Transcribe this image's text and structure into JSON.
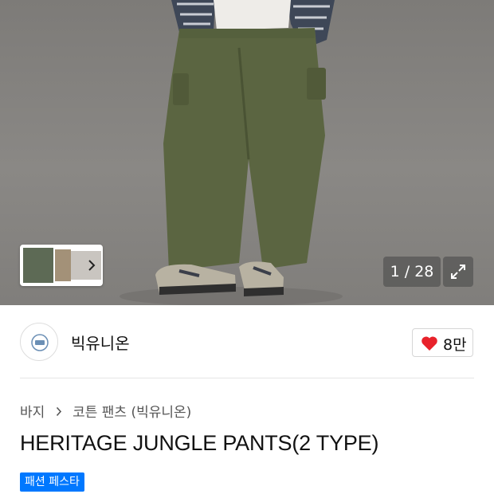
{
  "hero": {
    "counter": "1 / 28"
  },
  "brand": {
    "name": "빅유니온",
    "likes": "8만"
  },
  "breadcrumb": {
    "category": "바지",
    "subcategory": "코튼 팬츠 (빅유니온)"
  },
  "product": {
    "title": "HERITAGE JUNGLE PANTS(2 TYPE)",
    "badge": "패션 페스타"
  },
  "colors": {
    "accent_blue": "#0078ff",
    "heart_red": "#e8222b"
  },
  "icons": [
    "chevron-right-icon",
    "expand-icon",
    "heart-icon",
    "brand-logo"
  ]
}
